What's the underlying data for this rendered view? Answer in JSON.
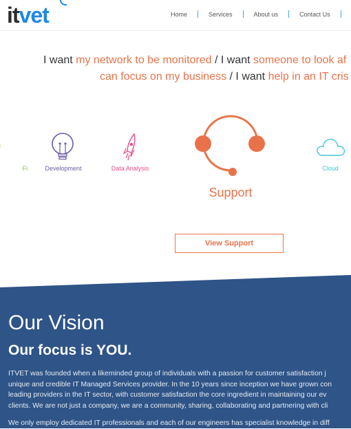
{
  "header": {
    "logo_it": "it",
    "logo_vet": "vet",
    "nav": [
      "Home",
      "Services",
      "About us",
      "Contact Us"
    ]
  },
  "hero": {
    "line1": [
      {
        "text": "I want ",
        "hl": false
      },
      {
        "text": "my network to be monitored",
        "hl": true
      },
      {
        "text": " / I want ",
        "hl": false
      },
      {
        "text": "someone to look af",
        "hl": true
      }
    ],
    "line2": [
      {
        "text": "can focus on my business",
        "hl": true
      },
      {
        "text": " / I want ",
        "hl": false
      },
      {
        "text": "help in an IT cris",
        "hl": true
      }
    ]
  },
  "services": {
    "wifi": "Fi",
    "development": "Development",
    "data_analysis": "Data Analysis",
    "support": "Support",
    "cloud": "Cloud",
    "button": "View Support"
  },
  "vision": {
    "title": "Our Vision",
    "subtitle": "Our focus is YOU.",
    "lines": [
      "ITVET was founded when a likeminded group of individuals with a passion for customer satisfaction j",
      "unique and credible IT Managed Services provider. In the 10 years since inception we have grown con",
      "leading providers in the IT sector, with customer satisfaction the core ingredient in maintaining our ev",
      "clients. We are not just a company, we are a community, sharing, collaborating and partnering with cli"
    ],
    "line5": "We only employ dedicated IT professionals and each of our engineers has specialist knowledge in diff"
  },
  "colors": {
    "accent": "#e8734a",
    "brand_blue": "#1e88e5",
    "vision_bg": "#2f5487",
    "wifi": "#8bc34a",
    "dev": "#6b5aa8",
    "data": "#e84a8f",
    "cloud": "#3ec5d8"
  },
  "icons": [
    "wifi-icon",
    "lightbulb-icon",
    "rocket-icon",
    "headset-icon",
    "cloud-icon"
  ]
}
